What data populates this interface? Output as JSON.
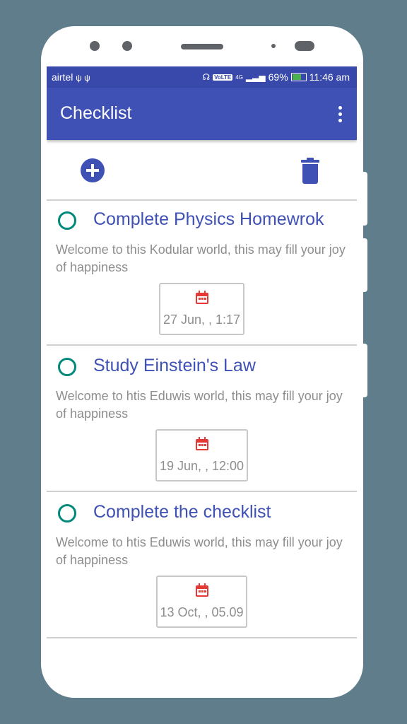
{
  "status_bar": {
    "carrier": "airtel",
    "network": "4G",
    "volte": "VoLTE",
    "battery_text": "69%",
    "battery_level": 0.69,
    "time": "11:46 am"
  },
  "app_bar": {
    "title": "Checklist"
  },
  "toolbar": {
    "add_icon": "plus-circle-icon",
    "delete_icon": "trash-icon"
  },
  "items": [
    {
      "title": "Complete Physics Homewrok",
      "description": "Welcome to this Kodular world, this may fill your joy of happiness",
      "date": "27 Jun, , 1:17"
    },
    {
      "title": "Study Einstein's Law",
      "description": "Welcome to htis Eduwis world, this may fill your joy of happiness",
      "date": "19 Jun, , 12:00"
    },
    {
      "title": "Complete the checklist",
      "description": "Welcome to htis Eduwis world, this may fill your joy of happiness",
      "date": "13 Oct, , 05.09"
    }
  ],
  "colors": {
    "primary": "#3f51b5",
    "status_bar": "#3949ab",
    "radio": "#00897b",
    "calendar": "#e53935",
    "background": "#607d8b"
  }
}
